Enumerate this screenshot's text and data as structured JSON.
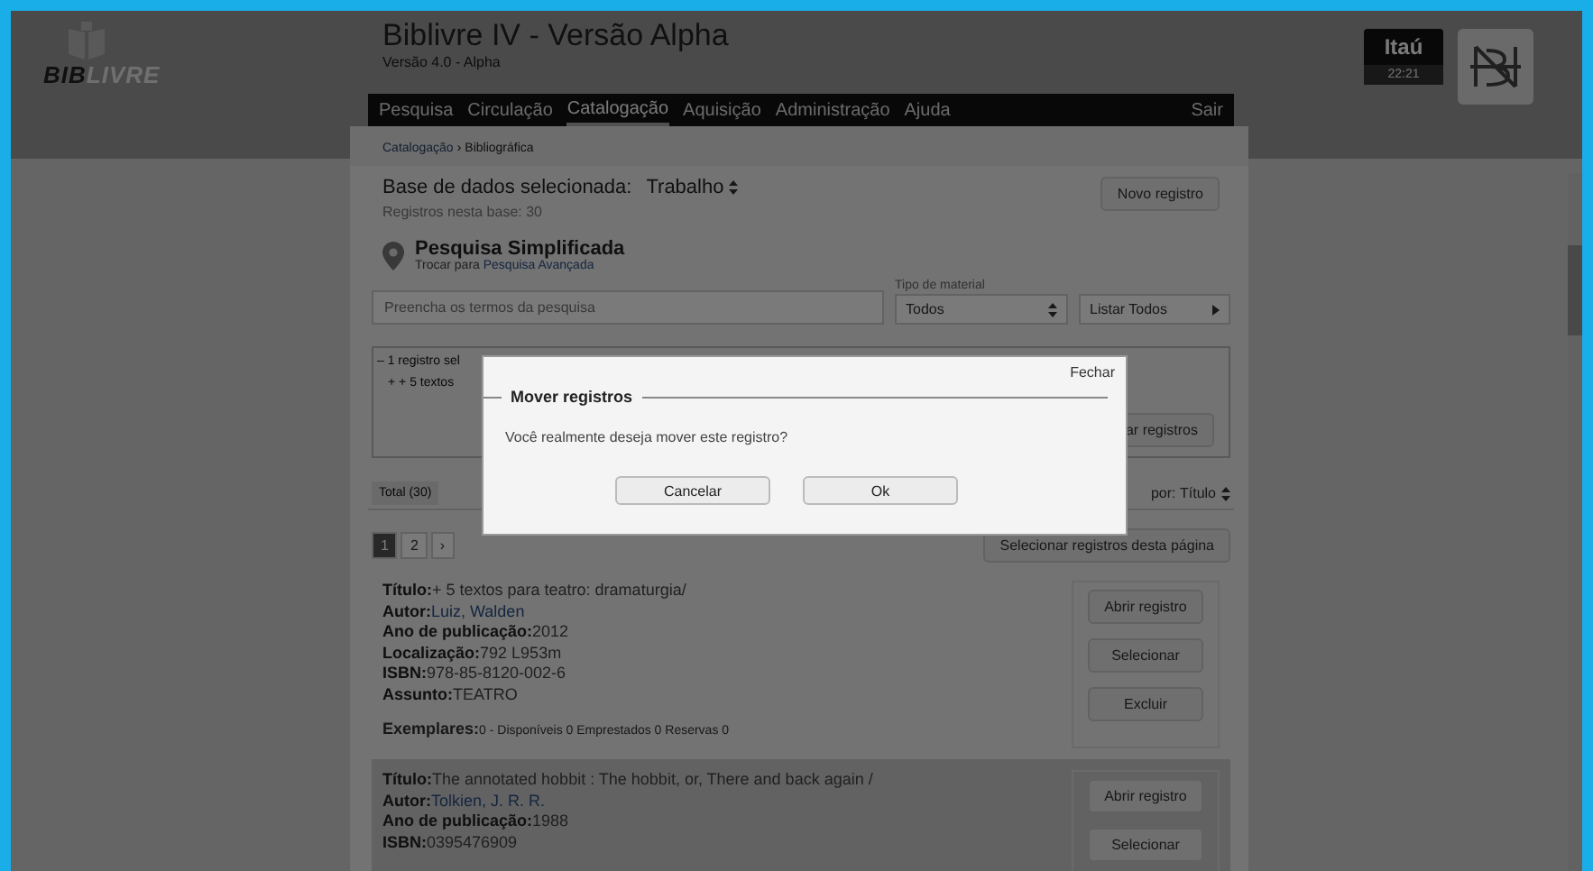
{
  "logo": {
    "part_a": "BIB",
    "part_b": "LIVRE"
  },
  "header": {
    "title": "Biblivre IV - Versão Alpha",
    "subtitle": "Versão 4.0 - Alpha"
  },
  "bank": {
    "name": "Itaú",
    "time": "22:21"
  },
  "nav": {
    "items": [
      {
        "label": "Pesquisa",
        "selected": false
      },
      {
        "label": "Circulação",
        "selected": false
      },
      {
        "label": "Catalogação",
        "selected": true
      },
      {
        "label": "Aquisição",
        "selected": false
      },
      {
        "label": "Administração",
        "selected": false
      },
      {
        "label": "Ajuda",
        "selected": false
      }
    ],
    "logout": "Sair"
  },
  "breadcrumb": {
    "parent": "Catalogação",
    "separator": "›",
    "current": "Bibliográfica"
  },
  "database": {
    "label": "Base de dados selecionada:",
    "value": "Trabalho",
    "count": "Registros nesta base: 30",
    "new_button": "Novo registro"
  },
  "search": {
    "title": "Pesquisa Simplificada",
    "toggle_prefix": "Trocar para",
    "toggle_link": "Pesquisa Avançada",
    "placeholder": "Preencha os termos da pesquisa",
    "material_label": "Tipo de material",
    "material_value": "Todos",
    "list_all": "Listar Todos"
  },
  "selection": {
    "header": "– 1 registro sel",
    "item": "+ + 5 textos",
    "button": "ar registros"
  },
  "results": {
    "total": "Total (30)",
    "sort_label": "por:",
    "sort_value": "Título",
    "pages": [
      {
        "label": "1",
        "selected": true
      },
      {
        "label": "2",
        "selected": false
      },
      {
        "label": "›",
        "selected": false
      }
    ],
    "select_page": "Selecionar registros desta página"
  },
  "records": [
    {
      "fields": [
        {
          "label": "Título:",
          "value": "+ 5 textos para teatro: dramaturgia/"
        },
        {
          "label": "Autor:",
          "value": "Luiz, Walden"
        },
        {
          "label": "Ano de publicação:",
          "value": "2012"
        },
        {
          "label": "Localização:",
          "value": "792 L953m"
        },
        {
          "label": "ISBN:",
          "value": "978-85-8120-002-6"
        },
        {
          "label": "Assunto:",
          "value": "TEATRO"
        }
      ],
      "holdings_label": "Exemplares:",
      "holdings": "0 - Disponíveis 0 Emprestados 0 Reservas 0",
      "buttons": [
        "Abrir registro",
        "Selecionar",
        "Excluir"
      ]
    },
    {
      "fields": [
        {
          "label": "Título:",
          "value": "The annotated hobbit : The hobbit, or, There and back again /"
        },
        {
          "label": "Autor:",
          "value": "Tolkien, J. R. R."
        },
        {
          "label": "Ano de publicação:",
          "value": "1988"
        },
        {
          "label": "ISBN:",
          "value": "0395476909"
        }
      ],
      "buttons": [
        "Abrir registro",
        "Selecionar"
      ]
    }
  ],
  "dialog": {
    "close": "Fechar",
    "title": "Mover registros",
    "message": "Você realmente deseja mover este registro?",
    "buttons": [
      "Cancelar",
      "Ok"
    ]
  }
}
